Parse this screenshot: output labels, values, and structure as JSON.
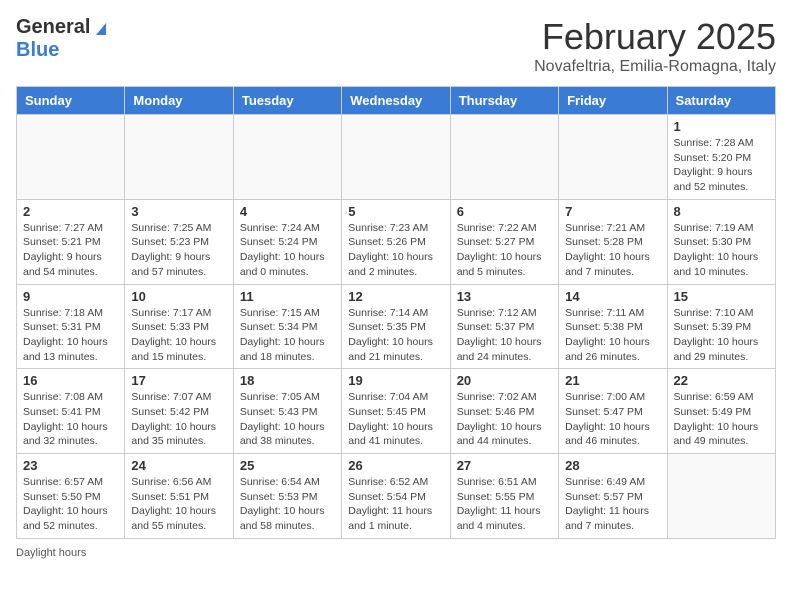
{
  "header": {
    "logo_general": "General",
    "logo_blue": "Blue",
    "month_title": "February 2025",
    "location": "Novafeltria, Emilia-Romagna, Italy"
  },
  "days_of_week": [
    "Sunday",
    "Monday",
    "Tuesday",
    "Wednesday",
    "Thursday",
    "Friday",
    "Saturday"
  ],
  "weeks": [
    [
      {
        "day": "",
        "info": ""
      },
      {
        "day": "",
        "info": ""
      },
      {
        "day": "",
        "info": ""
      },
      {
        "day": "",
        "info": ""
      },
      {
        "day": "",
        "info": ""
      },
      {
        "day": "",
        "info": ""
      },
      {
        "day": "1",
        "info": "Sunrise: 7:28 AM\nSunset: 5:20 PM\nDaylight: 9 hours and 52 minutes."
      }
    ],
    [
      {
        "day": "2",
        "info": "Sunrise: 7:27 AM\nSunset: 5:21 PM\nDaylight: 9 hours and 54 minutes."
      },
      {
        "day": "3",
        "info": "Sunrise: 7:25 AM\nSunset: 5:23 PM\nDaylight: 9 hours and 57 minutes."
      },
      {
        "day": "4",
        "info": "Sunrise: 7:24 AM\nSunset: 5:24 PM\nDaylight: 10 hours and 0 minutes."
      },
      {
        "day": "5",
        "info": "Sunrise: 7:23 AM\nSunset: 5:26 PM\nDaylight: 10 hours and 2 minutes."
      },
      {
        "day": "6",
        "info": "Sunrise: 7:22 AM\nSunset: 5:27 PM\nDaylight: 10 hours and 5 minutes."
      },
      {
        "day": "7",
        "info": "Sunrise: 7:21 AM\nSunset: 5:28 PM\nDaylight: 10 hours and 7 minutes."
      },
      {
        "day": "8",
        "info": "Sunrise: 7:19 AM\nSunset: 5:30 PM\nDaylight: 10 hours and 10 minutes."
      }
    ],
    [
      {
        "day": "9",
        "info": "Sunrise: 7:18 AM\nSunset: 5:31 PM\nDaylight: 10 hours and 13 minutes."
      },
      {
        "day": "10",
        "info": "Sunrise: 7:17 AM\nSunset: 5:33 PM\nDaylight: 10 hours and 15 minutes."
      },
      {
        "day": "11",
        "info": "Sunrise: 7:15 AM\nSunset: 5:34 PM\nDaylight: 10 hours and 18 minutes."
      },
      {
        "day": "12",
        "info": "Sunrise: 7:14 AM\nSunset: 5:35 PM\nDaylight: 10 hours and 21 minutes."
      },
      {
        "day": "13",
        "info": "Sunrise: 7:12 AM\nSunset: 5:37 PM\nDaylight: 10 hours and 24 minutes."
      },
      {
        "day": "14",
        "info": "Sunrise: 7:11 AM\nSunset: 5:38 PM\nDaylight: 10 hours and 26 minutes."
      },
      {
        "day": "15",
        "info": "Sunrise: 7:10 AM\nSunset: 5:39 PM\nDaylight: 10 hours and 29 minutes."
      }
    ],
    [
      {
        "day": "16",
        "info": "Sunrise: 7:08 AM\nSunset: 5:41 PM\nDaylight: 10 hours and 32 minutes."
      },
      {
        "day": "17",
        "info": "Sunrise: 7:07 AM\nSunset: 5:42 PM\nDaylight: 10 hours and 35 minutes."
      },
      {
        "day": "18",
        "info": "Sunrise: 7:05 AM\nSunset: 5:43 PM\nDaylight: 10 hours and 38 minutes."
      },
      {
        "day": "19",
        "info": "Sunrise: 7:04 AM\nSunset: 5:45 PM\nDaylight: 10 hours and 41 minutes."
      },
      {
        "day": "20",
        "info": "Sunrise: 7:02 AM\nSunset: 5:46 PM\nDaylight: 10 hours and 44 minutes."
      },
      {
        "day": "21",
        "info": "Sunrise: 7:00 AM\nSunset: 5:47 PM\nDaylight: 10 hours and 46 minutes."
      },
      {
        "day": "22",
        "info": "Sunrise: 6:59 AM\nSunset: 5:49 PM\nDaylight: 10 hours and 49 minutes."
      }
    ],
    [
      {
        "day": "23",
        "info": "Sunrise: 6:57 AM\nSunset: 5:50 PM\nDaylight: 10 hours and 52 minutes."
      },
      {
        "day": "24",
        "info": "Sunrise: 6:56 AM\nSunset: 5:51 PM\nDaylight: 10 hours and 55 minutes."
      },
      {
        "day": "25",
        "info": "Sunrise: 6:54 AM\nSunset: 5:53 PM\nDaylight: 10 hours and 58 minutes."
      },
      {
        "day": "26",
        "info": "Sunrise: 6:52 AM\nSunset: 5:54 PM\nDaylight: 11 hours and 1 minute."
      },
      {
        "day": "27",
        "info": "Sunrise: 6:51 AM\nSunset: 5:55 PM\nDaylight: 11 hours and 4 minutes."
      },
      {
        "day": "28",
        "info": "Sunrise: 6:49 AM\nSunset: 5:57 PM\nDaylight: 11 hours and 7 minutes."
      },
      {
        "day": "",
        "info": ""
      }
    ]
  ],
  "footer": {
    "daylight_label": "Daylight hours"
  }
}
